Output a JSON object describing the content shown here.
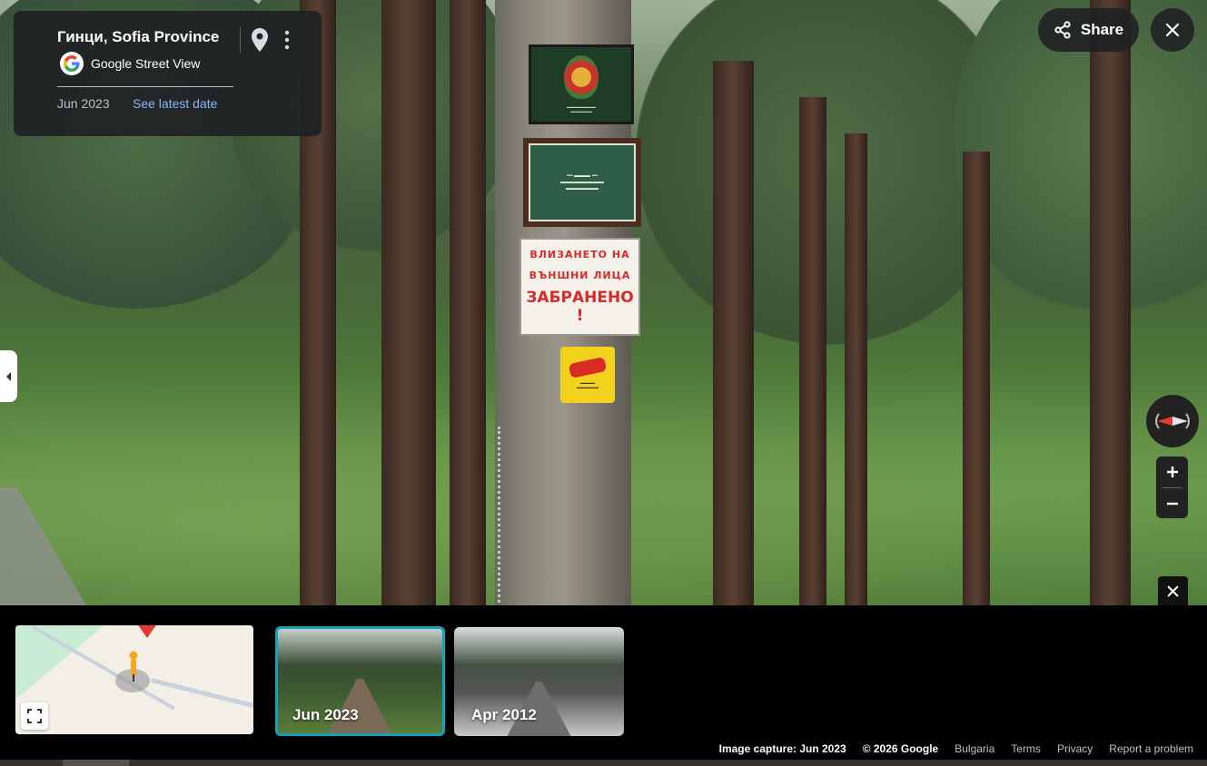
{
  "header": {
    "location_title": "Гинци, Sofia Province",
    "provider_label": "Google Street View",
    "capture_date": "Jun 2023",
    "see_latest_label": "See latest date"
  },
  "topbar": {
    "share_label": "Share"
  },
  "scene": {
    "signs": {
      "warning_line1": "ВЛИЗАНЕТО НА",
      "warning_line2": "ВЪНШНИ ЛИЦА",
      "warning_line3": "ЗАБРАНЕНО !"
    }
  },
  "filmstrip": {
    "thumbnails": [
      {
        "label": "Jun 2023",
        "selected": true
      },
      {
        "label": "Apr 2012",
        "selected": false
      }
    ]
  },
  "footer": {
    "image_capture": "Image capture: Jun 2023",
    "copyright": "© 2026 Google",
    "country": "Bulgaria",
    "terms": "Terms",
    "privacy": "Privacy",
    "report": "Report a problem"
  },
  "colors": {
    "accent_link": "#8ab4f8",
    "selected_thumb_border": "#12a5b8",
    "panel_bg": "#202124",
    "marker_red": "#e53935"
  },
  "icons": [
    "share-icon",
    "close-icon",
    "pin-icon",
    "more-vert-icon",
    "chevron-left-icon",
    "compass-icon",
    "zoom-in-icon",
    "zoom-out-icon",
    "fullscreen-icon",
    "google-logo-icon",
    "pegman-icon"
  ]
}
